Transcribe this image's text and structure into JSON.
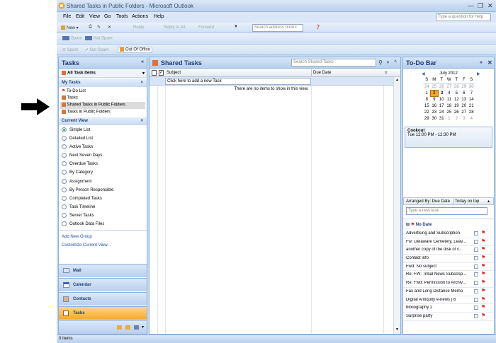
{
  "window": {
    "title": "Shared Tasks in Public Folders - Microsoft Outlook"
  },
  "menu": [
    "File",
    "Edit",
    "View",
    "Go",
    "Tools",
    "Actions",
    "Help"
  ],
  "help_placeholder": "Type a question for help",
  "toolbar1": {
    "new": "New",
    "reply": "Reply",
    "reply_all": "Reply to All",
    "forward": "Forward",
    "search_placeholder": "Search address books"
  },
  "toolbar2": {
    "spam": "Spam",
    "not_spam": "Not Spam"
  },
  "toolbar3": {
    "spam": "Spam",
    "not_spam": "Not Spam",
    "out_of_office": "Out Of Office"
  },
  "nav": {
    "header": "Tasks",
    "all_items": "All Task Items",
    "my_tasks_label": "My Tasks",
    "my_tasks": [
      "To-Do List",
      "Tasks",
      "Shared Tasks in Public Folders",
      "Tasks in Public Folders"
    ],
    "current_view_label": "Current View",
    "views": [
      "Simple List",
      "Detailed List",
      "Active Tasks",
      "Next Seven Days",
      "Overdue Tasks",
      "By Category",
      "Assignment",
      "By Person Responsible",
      "Completed Tasks",
      "Task Timeline",
      "Server Tasks",
      "Outlook Data Files"
    ],
    "links": [
      "Add New Group",
      "Customize Current View..."
    ],
    "buttons": [
      "Mail",
      "Calendar",
      "Contacts",
      "Tasks"
    ]
  },
  "main": {
    "title": "Shared Tasks",
    "search_placeholder": "Search Shared Tasks",
    "col_subject": "Subject",
    "col_due": "Due Date",
    "new_task_prompt": "Click here to add a new Task",
    "empty_message": "There are no items to show in this view."
  },
  "todo": {
    "title": "To-Do Bar",
    "month": "July 2012",
    "weekdays": [
      "S",
      "M",
      "T",
      "W",
      "T",
      "F",
      "S"
    ],
    "weeks": [
      [
        "24",
        "25",
        "26",
        "27",
        "28",
        "29",
        "30"
      ],
      [
        "1",
        "2",
        "3",
        "4",
        "5",
        "6",
        "7"
      ],
      [
        "8",
        "9",
        "10",
        "11",
        "12",
        "13",
        "14"
      ],
      [
        "15",
        "16",
        "17",
        "18",
        "19",
        "20",
        "21"
      ],
      [
        "22",
        "23",
        "24",
        "25",
        "26",
        "27",
        "28"
      ],
      [
        "29",
        "30",
        "31",
        "1",
        "2",
        "3",
        "4"
      ]
    ],
    "appointment_title": "Cookout",
    "appointment_time": "Tue 12:00 PM - 12:30 PM",
    "arranged_by": "Arranged By: Due Date",
    "sort": "Today on top",
    "new_task_placeholder": "Type a new task",
    "group": "No Date",
    "tasks": [
      "Advertising and Subscription",
      "Fw: Delaware Cemetery, Leav...",
      "another copy of the disk of c...",
      "Contact info",
      "Fwd: No subject",
      "Re: FW: Tribal News Subscrip...",
      "Re: Fwd: Permission to Archiv...",
      "Fax and Long Distance Memo",
      "Digital Antiquity e-news | 6",
      "bibliography 2",
      "Surprise party"
    ]
  },
  "status": "0 Items",
  "colors": {
    "accent": "#1e3d6e",
    "selected": "#f6a825",
    "flag": "#d8241c",
    "today": "#f1a52f"
  }
}
